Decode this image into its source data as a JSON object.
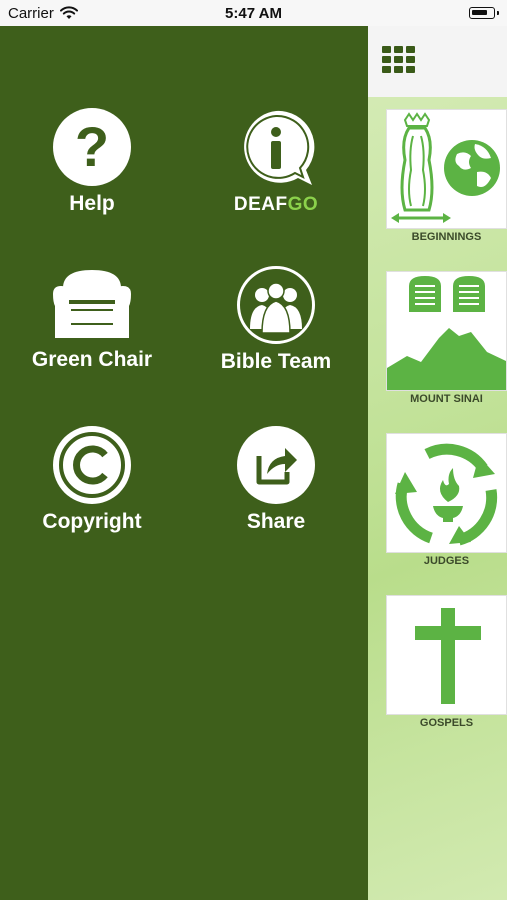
{
  "status": {
    "carrier": "Carrier",
    "time": "5:47 AM"
  },
  "menu": {
    "help": "Help",
    "deafgo_a": "DEAF",
    "deafgo_b": "GO",
    "green_chair": "Green Chair",
    "bible_team": "Bible Team",
    "copyright": "Copyright",
    "share": "Share"
  },
  "cards": [
    "BEGINNINGS",
    "MOUNT SINAI",
    "JUDGES",
    "GOSPELS"
  ],
  "colors": {
    "menu_bg": "#3e5f1b",
    "accent_green": "#5cb344",
    "deafgo_green": "#8bd14b"
  }
}
